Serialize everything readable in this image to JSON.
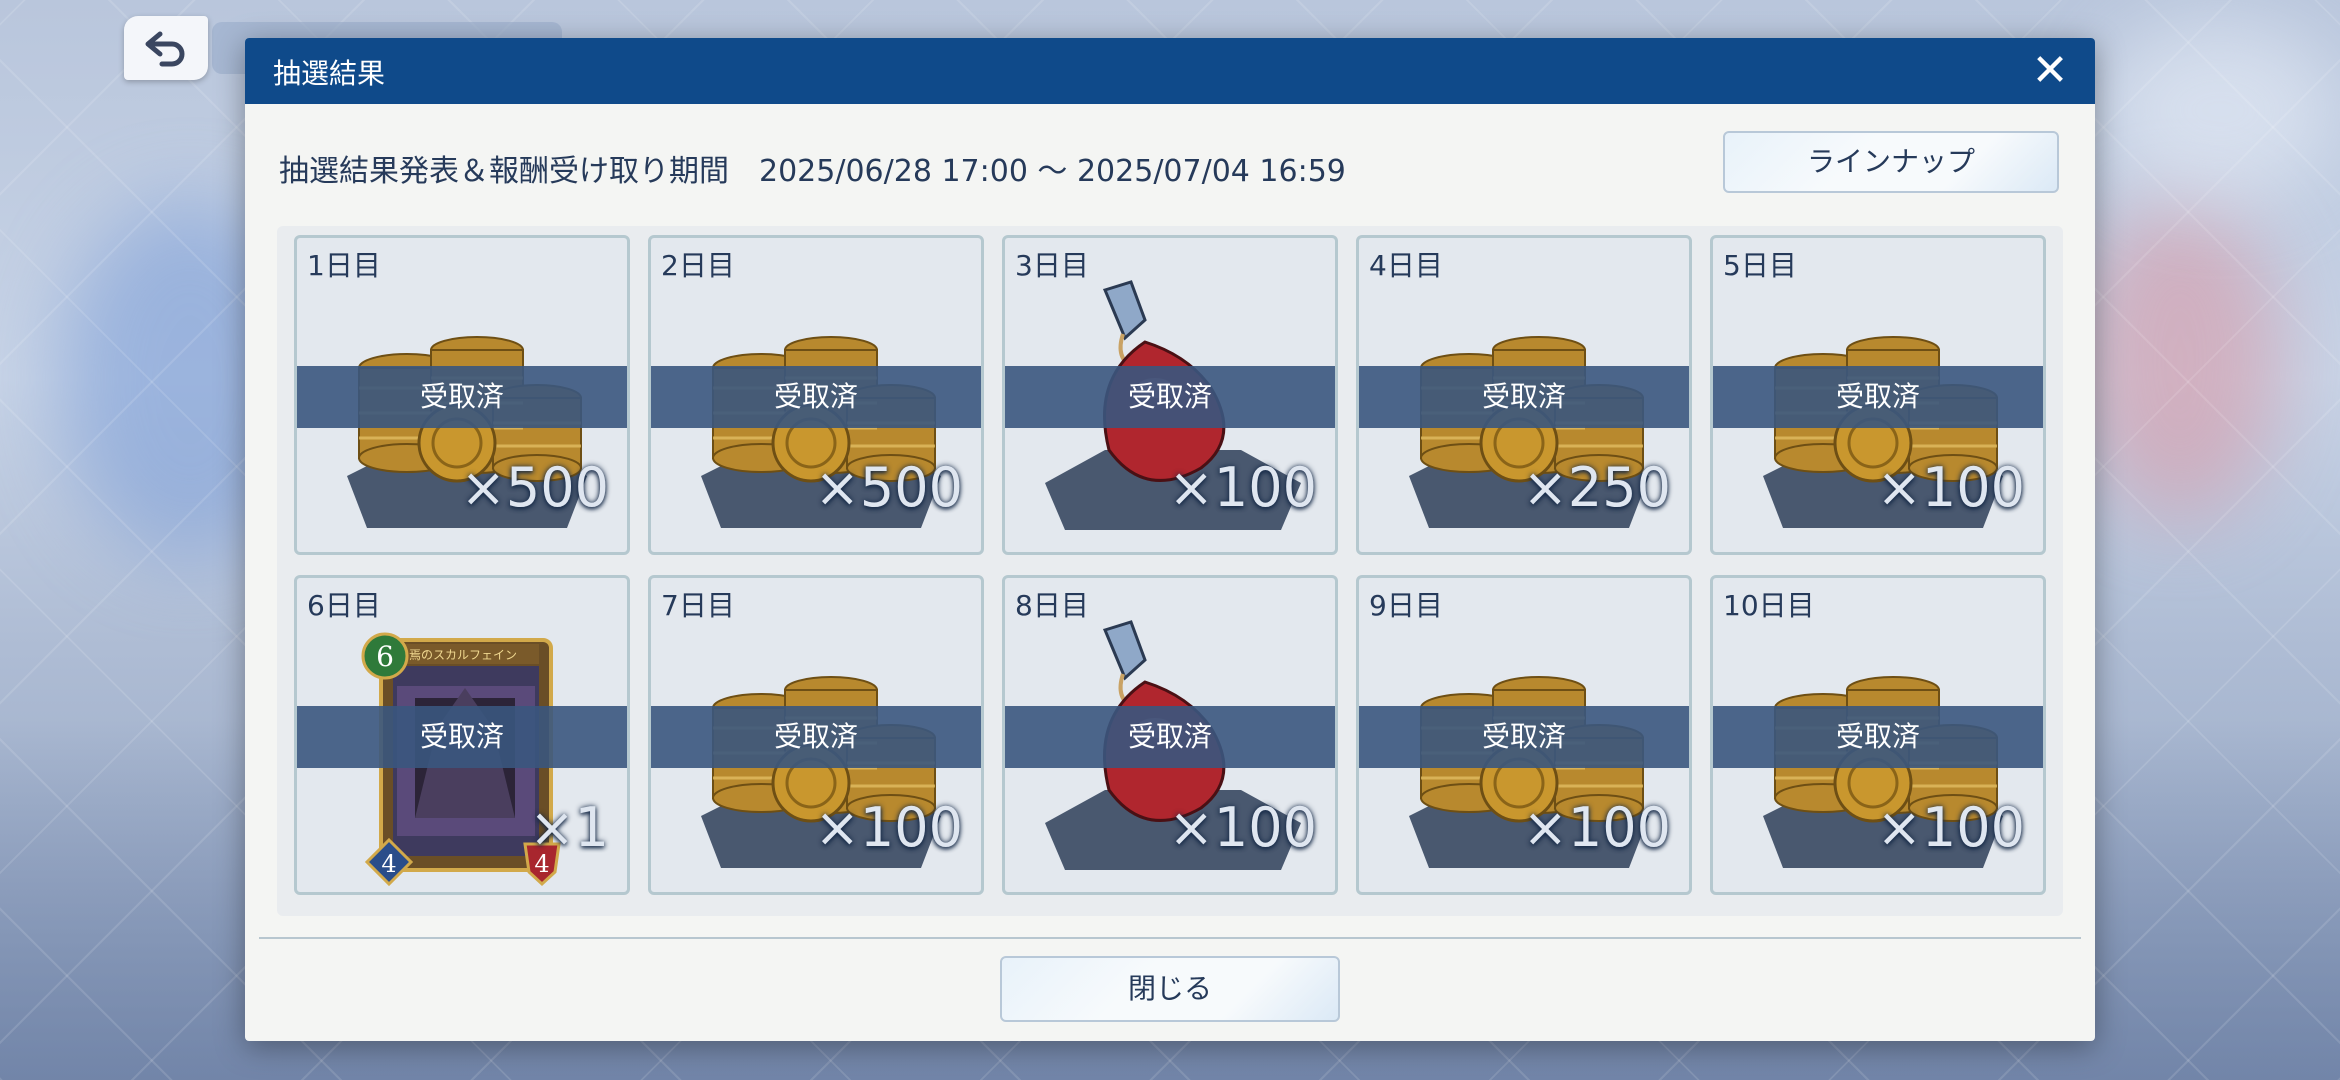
{
  "dialog": {
    "title": "抽選結果",
    "period_text": "抽選結果発表＆報酬受け取り期間　2025/06/28 17:00 ～ 2025/07/04 16:59",
    "lineup_label": "ラインナップ",
    "close_label": "閉じる"
  },
  "rewards": [
    {
      "day": "1日目",
      "item": "gold-coins",
      "qty": "×500",
      "status": "受取済"
    },
    {
      "day": "2日目",
      "item": "gold-coins",
      "qty": "×500",
      "status": "受取済"
    },
    {
      "day": "3日目",
      "item": "red-potion",
      "qty": "×100",
      "status": "受取済"
    },
    {
      "day": "4日目",
      "item": "gold-coins",
      "qty": "×250",
      "status": "受取済"
    },
    {
      "day": "5日目",
      "item": "gold-coins",
      "qty": "×100",
      "status": "受取済"
    },
    {
      "day": "6日目",
      "item": "card",
      "qty": "×1",
      "status": "受取済",
      "card": {
        "name": "終焉のスカルフェイン",
        "cost": "6",
        "attack": "4",
        "defense": "4"
      }
    },
    {
      "day": "7日目",
      "item": "gold-coins",
      "qty": "×100",
      "status": "受取済"
    },
    {
      "day": "8日目",
      "item": "red-potion",
      "qty": "×100",
      "status": "受取済"
    },
    {
      "day": "9日目",
      "item": "gold-coins",
      "qty": "×100",
      "status": "受取済"
    },
    {
      "day": "10日目",
      "item": "gold-coins",
      "qty": "×100",
      "status": "受取済"
    }
  ],
  "icons": {
    "back": "back-arrow-icon",
    "close": "close-icon"
  },
  "colors": {
    "title_bar": "#0f4a8a",
    "claimed_band": "#3a567e",
    "text": "#263a5a"
  }
}
